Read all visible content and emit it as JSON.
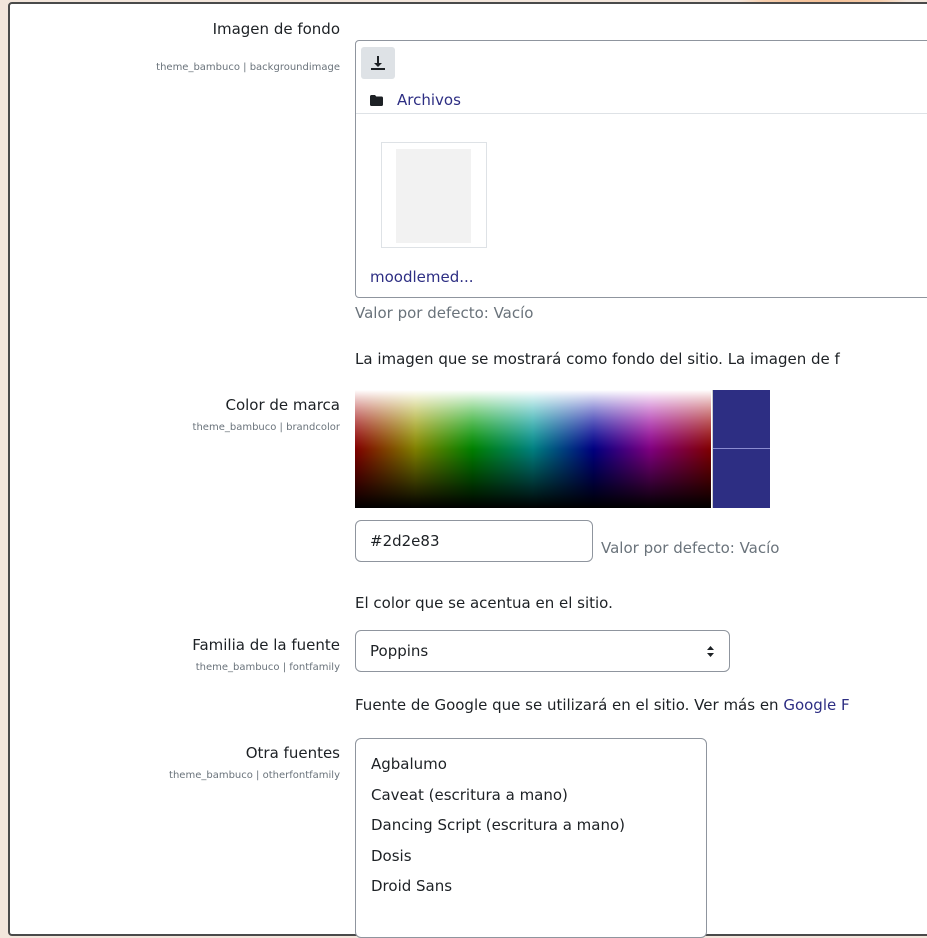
{
  "background_image": {
    "label": "Imagen de fondo",
    "setting": "theme_bambuco | backgroundimage",
    "path_label": "Archivos",
    "file_name": "moodlemed...",
    "default": "Valor por defecto: Vacío",
    "description": "La imagen que se mostrará como fondo del sitio. La imagen de f",
    "icons": {
      "download": "download-icon",
      "folder": "folder-icon"
    }
  },
  "brand_color": {
    "label": "Color de marca",
    "setting": "theme_bambuco | brandcolor",
    "value": "#2d2e83",
    "default": "Valor por defecto: Vacío",
    "description": "El color que se acentua en el sitio.",
    "swatch_color": "#2d2e83"
  },
  "font_family": {
    "label": "Familia de la fuente",
    "setting": "theme_bambuco | fontfamily",
    "selected": "Poppins",
    "description_prefix": "Fuente de Google que se utilizará en el sitio. Ver más en ",
    "description_link": "Google F"
  },
  "other_fonts": {
    "label": "Otra fuentes",
    "setting": "theme_bambuco | otherfontfamily",
    "options": [
      "Agbalumo",
      "Caveat (escritura a mano)",
      "Dancing Script (escritura a mano)",
      "Dosis",
      "Droid Sans"
    ]
  }
}
